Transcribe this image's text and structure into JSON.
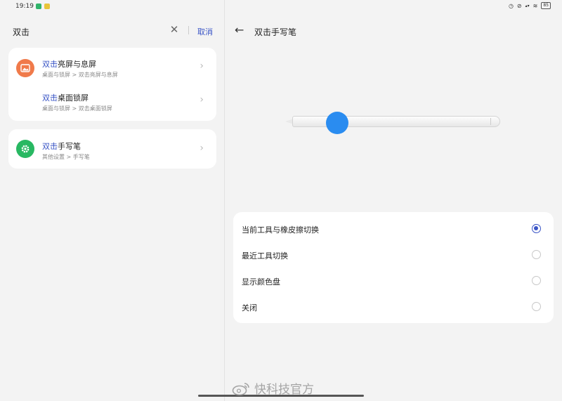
{
  "status_bar": {
    "time": "19:19",
    "battery": "85",
    "icons": [
      "alarm-icon",
      "mute-icon",
      "network-speed-icon",
      "wifi-icon",
      "battery-icon"
    ],
    "notif_colors": [
      "#2fb36a",
      "#e8c43a"
    ]
  },
  "search": {
    "query": "双击",
    "cancel_label": "取消"
  },
  "results": [
    {
      "highlight": "双击",
      "title_rest": "亮屏与息屏",
      "path": "桌面与锁屏 > 双击亮屏与息屏",
      "icon": "wallpaper-icon",
      "icon_color": "#f07a4a"
    },
    {
      "highlight": "双击",
      "title_rest": "桌面锁屏",
      "path": "桌面与锁屏 > 双击桌面锁屏",
      "icon": "",
      "icon_color": ""
    },
    {
      "highlight": "双击",
      "title_rest": "手写笔",
      "path": "其他设置 > 手写笔",
      "icon": "settings-gear-icon",
      "icon_color": "#28b862"
    }
  ],
  "detail": {
    "title": "双击手写笔",
    "options": [
      {
        "label": "当前工具与橡皮擦切换",
        "selected": true
      },
      {
        "label": "最近工具切换",
        "selected": false
      },
      {
        "label": "显示颜色盘",
        "selected": false
      },
      {
        "label": "关闭",
        "selected": false
      }
    ]
  },
  "watermark": {
    "text": "快科技官方"
  },
  "colors": {
    "accent": "#3a55c6",
    "touch_dot": "#2a8cf0",
    "background": "#f3f3f3",
    "card": "#ffffff"
  }
}
